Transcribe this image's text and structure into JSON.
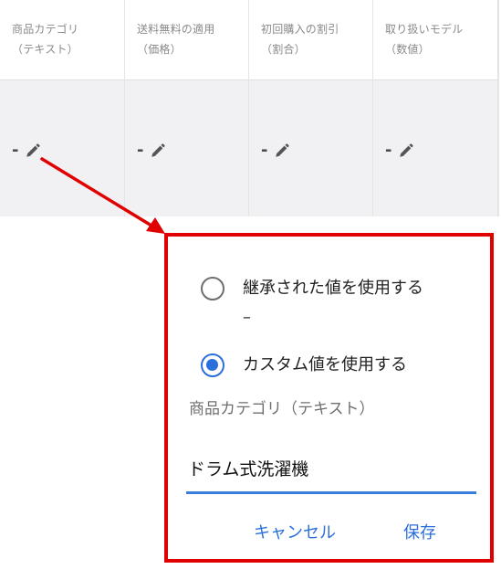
{
  "columns": [
    {
      "line1": "商品カテゴリ",
      "line2": "（テキスト）",
      "value": "-"
    },
    {
      "line1": "送料無料の適用",
      "line2": "（価格）",
      "value": "-"
    },
    {
      "line1": "初回購入の割引",
      "line2": "（割合）",
      "value": "-"
    },
    {
      "line1": "取り扱いモデル",
      "line2": "（数値）",
      "value": "-"
    }
  ],
  "popover": {
    "inherit_label": "継承された値を使用する",
    "inherit_value": "–",
    "custom_label": "カスタム値を使用する",
    "field_label": "商品カテゴリ（テキスト）",
    "field_value": "ドラム式洗濯機",
    "cancel_label": "キャンセル",
    "save_label": "保存"
  },
  "colors": {
    "callout": "#e00000",
    "accent": "#2a6fdb"
  }
}
